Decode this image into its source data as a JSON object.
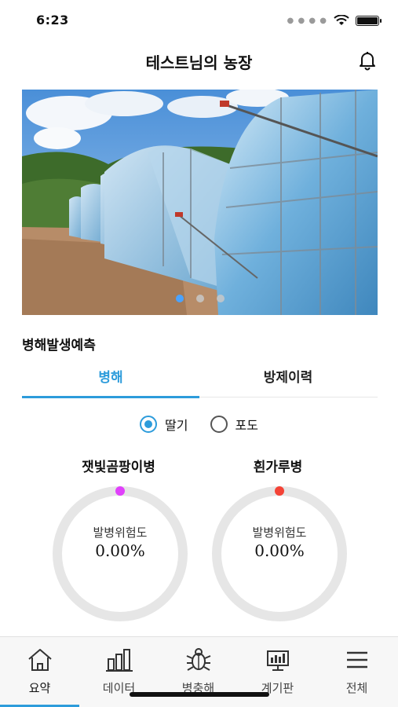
{
  "status_bar": {
    "time": "6:23"
  },
  "header": {
    "title": "테스트님의 농장",
    "bell_icon": "bell-icon"
  },
  "hero": {
    "slide_count": 3,
    "active_slide": 1
  },
  "section": {
    "title": "병해발생예측",
    "tabs": [
      {
        "label": "병해",
        "active": true
      },
      {
        "label": "방제이력",
        "active": false
      }
    ],
    "crops": [
      {
        "label": "딸기",
        "selected": true
      },
      {
        "label": "포도",
        "selected": false
      }
    ],
    "gauges": [
      {
        "name": "잿빛곰팡이병",
        "metric": "발병위험도",
        "value": "0.00%",
        "dot_color": "#e040fb"
      },
      {
        "name": "흰가루병",
        "metric": "발병위험도",
        "value": "0.00%",
        "dot_color": "#f44336"
      }
    ]
  },
  "bottom_nav": {
    "items": [
      {
        "label": "요약",
        "icon": "home-icon",
        "active": true
      },
      {
        "label": "데이터",
        "icon": "bar-chart-icon",
        "active": false
      },
      {
        "label": "병충해",
        "icon": "bug-icon",
        "active": false
      },
      {
        "label": "계기판",
        "icon": "dashboard-icon",
        "active": false
      },
      {
        "label": "전체",
        "icon": "menu-icon",
        "active": false
      }
    ]
  },
  "colors": {
    "accent": "#2d9cdb",
    "ring": "#e6e6e6"
  }
}
